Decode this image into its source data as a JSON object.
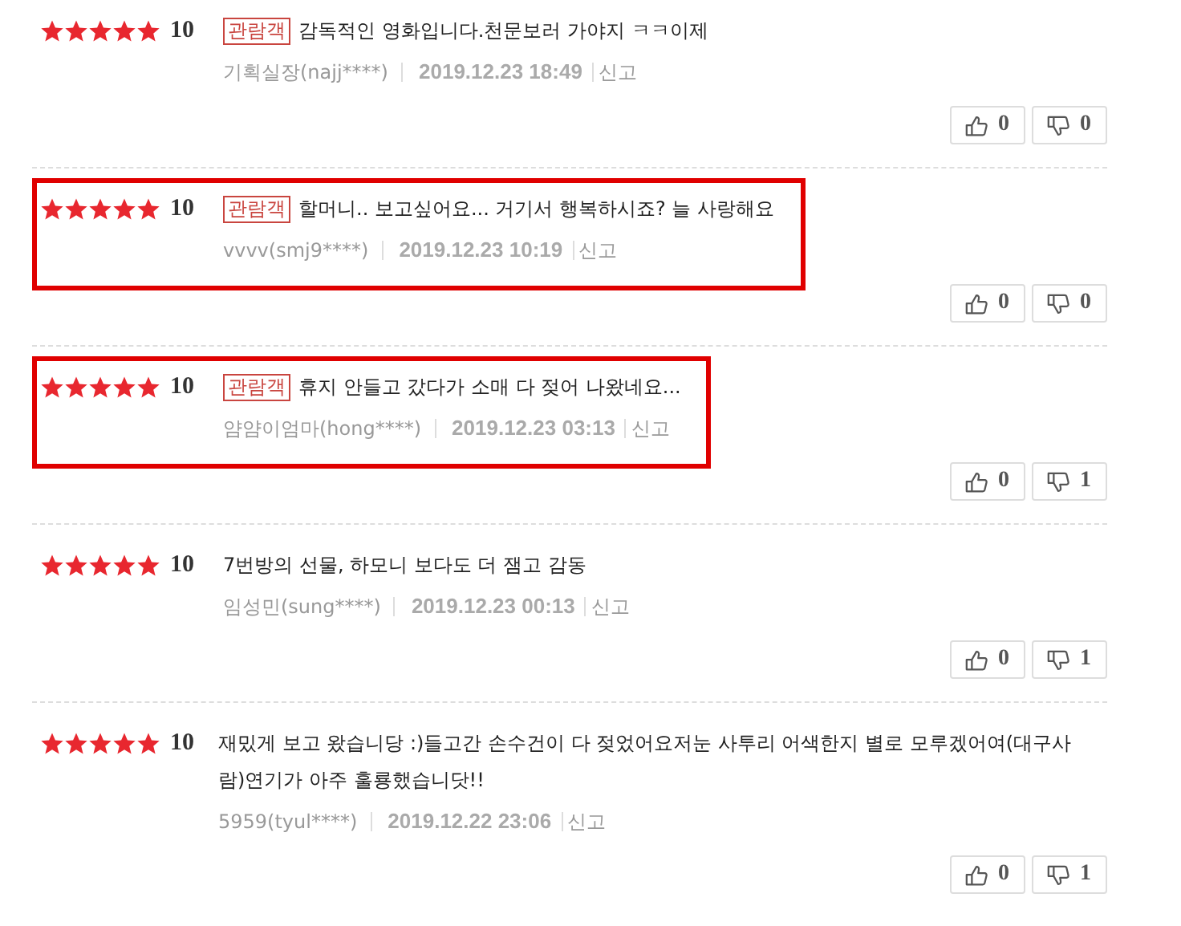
{
  "reviews": [
    {
      "stars": 5,
      "score": "10",
      "badge": "관람객",
      "text": "감독적인 영화입니다.천문보러 가야지 ㅋㅋ이제",
      "author": "기획실장(najj****)",
      "date": "2019.12.23 18:49",
      "report": "신고",
      "likes": "0",
      "dislikes": "0",
      "highlighted": false
    },
    {
      "stars": 5,
      "score": "10",
      "badge": "관람객",
      "text": "할머니.. 보고싶어요... 거기서 행복하시죠? 늘 사랑해요",
      "author": "vvvv(smj9****)",
      "date": "2019.12.23 10:19",
      "report": "신고",
      "likes": "0",
      "dislikes": "0",
      "highlighted": true
    },
    {
      "stars": 5,
      "score": "10",
      "badge": "관람객",
      "text": "휴지 안들고 갔다가 소매 다 젖어 나왔네요...",
      "author": "얌얌이엄마(hong****)",
      "date": "2019.12.23 03:13",
      "report": "신고",
      "likes": "0",
      "dislikes": "1",
      "highlighted": true
    },
    {
      "stars": 5,
      "score": "10",
      "text": "7번방의 선물, 하모니 보다도 더 잼고 감동",
      "author": "임성민(sung****)",
      "date": "2019.12.23 00:13",
      "report": "신고",
      "likes": "0",
      "dislikes": "1",
      "highlighted": false
    },
    {
      "stars": 5,
      "score": "10",
      "text": "재밌게 보고 왔습니당 :)들고간 손수건이 다 젖었어요저눈 사투리 어색한지 별로 모루겠어여(대구사람)연기가 아주 훌룡했습니닷!!",
      "author": "5959(tyul****)",
      "date": "2019.12.22 23:06",
      "report": "신고",
      "likes": "0",
      "dislikes": "1",
      "highlighted": false
    }
  ]
}
